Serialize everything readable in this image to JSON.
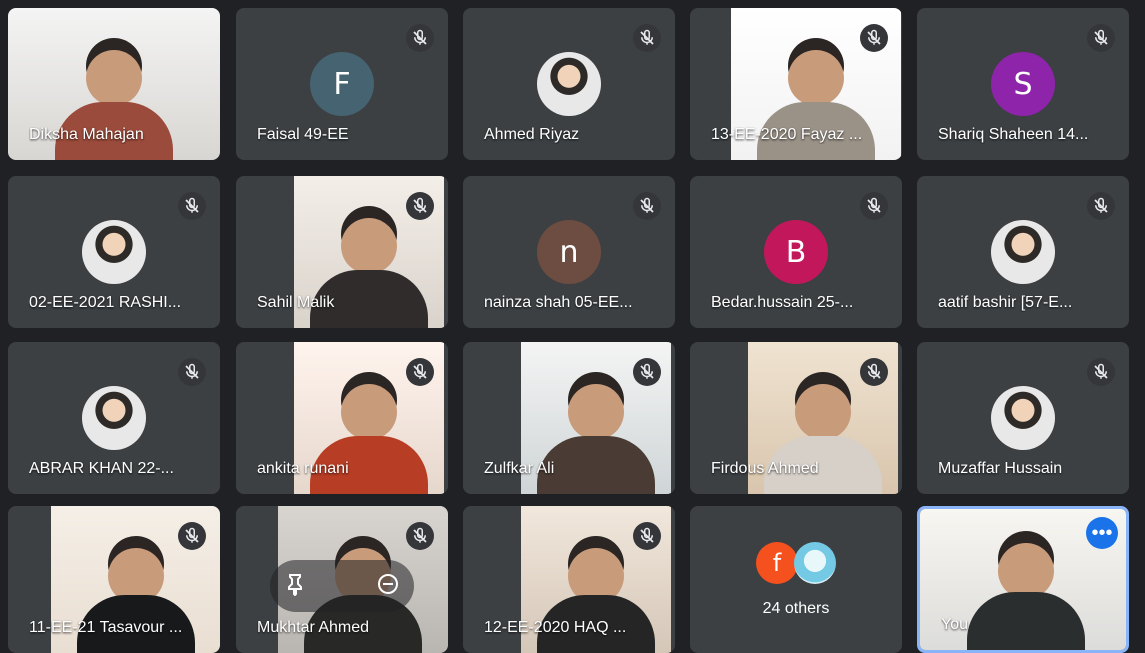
{
  "meeting": {
    "participants": [
      {
        "name": "Diksha Mahajan",
        "kind": "video",
        "muted": false
      },
      {
        "name": "Faisal 49-EE",
        "kind": "letter",
        "initial": "F",
        "color": "#456371",
        "muted": true
      },
      {
        "name": "Ahmed Riyaz",
        "kind": "photo",
        "muted": true
      },
      {
        "name": "13-EE-2020 Fayaz ...",
        "kind": "video",
        "muted": true
      },
      {
        "name": "Shariq Shaheen 14...",
        "kind": "letter",
        "initial": "S",
        "color": "#8e24aa",
        "muted": true
      },
      {
        "name": "02-EE-2021 RASHI...",
        "kind": "photo",
        "muted": true
      },
      {
        "name": "Sahil Malik",
        "kind": "video",
        "muted": true
      },
      {
        "name": "nainza shah 05-EE...",
        "kind": "letter",
        "initial": "n",
        "color": "#6d4c41",
        "muted": true
      },
      {
        "name": "Bedar.hussain 25-...",
        "kind": "letter",
        "initial": "B",
        "color": "#c2185b",
        "muted": true
      },
      {
        "name": "aatif bashir [57-E...",
        "kind": "photo",
        "muted": true
      },
      {
        "name": "ABRAR KHAN 22-...",
        "kind": "photo",
        "muted": true
      },
      {
        "name": "ankita runani",
        "kind": "video",
        "muted": true
      },
      {
        "name": "Zulfkar Ali",
        "kind": "video",
        "muted": true
      },
      {
        "name": "Firdous Ahmed",
        "kind": "video",
        "muted": true
      },
      {
        "name": "Muzaffar Hussain",
        "kind": "photo",
        "muted": true
      },
      {
        "name": "11-EE-21 Tasavour ...",
        "kind": "video",
        "muted": true
      },
      {
        "name": "Mukhtar Ahmed",
        "kind": "video",
        "muted": true,
        "hover": true
      },
      {
        "name": "12-EE-2020 HAQ ...",
        "kind": "video",
        "muted": true
      },
      {
        "name": "",
        "kind": "others",
        "count_label": "24 others",
        "initials": [
          "f",
          ""
        ],
        "muted": false
      },
      {
        "name": "You",
        "kind": "self",
        "muted": false
      }
    ],
    "colors": {
      "background": "#202124",
      "tile": "#3c4043",
      "self_border": "#8ab4f8",
      "more_button": "#1a73e8"
    }
  }
}
